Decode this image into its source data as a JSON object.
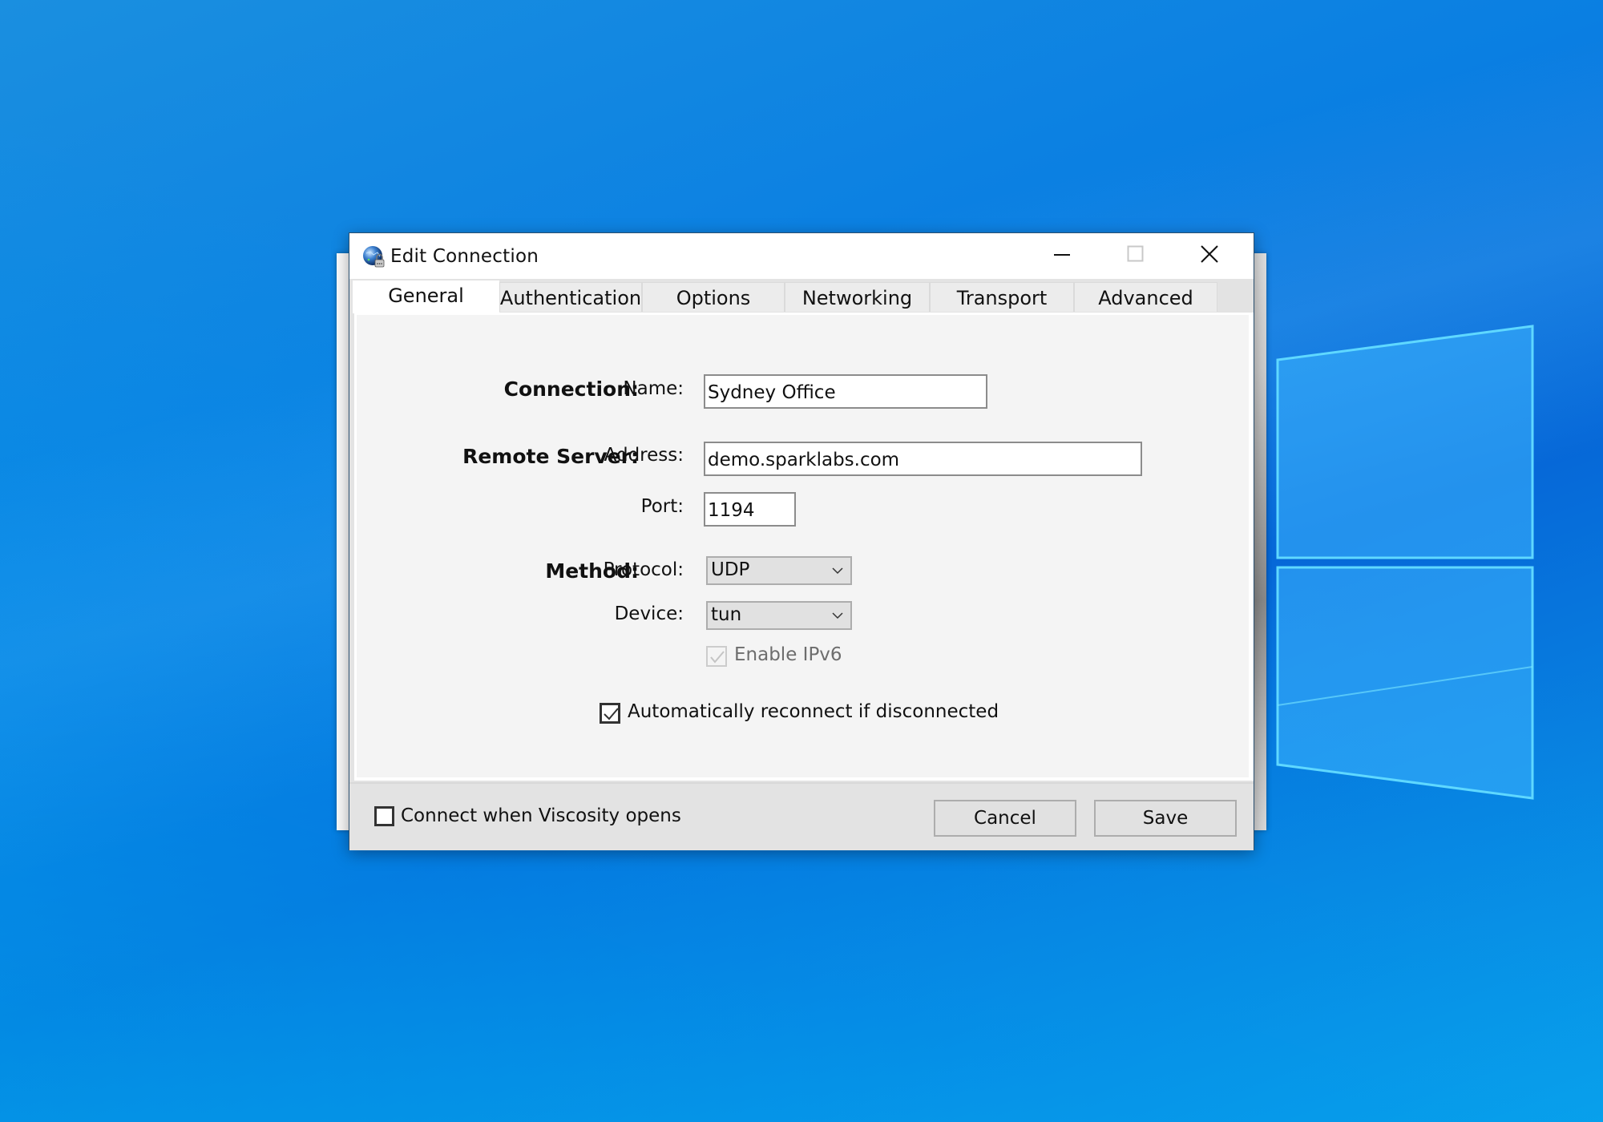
{
  "window": {
    "title": "Edit Connection",
    "app_icon": "globe-lock-icon",
    "controls": {
      "minimize": "minimize-icon",
      "maximize": "maximize-icon",
      "close": "close-icon"
    }
  },
  "tabs": [
    {
      "label": "General",
      "active": true
    },
    {
      "label": "Authentication",
      "active": false
    },
    {
      "label": "Options",
      "active": false
    },
    {
      "label": "Networking",
      "active": false
    },
    {
      "label": "Transport",
      "active": false
    },
    {
      "label": "Advanced",
      "active": false
    }
  ],
  "general": {
    "connection_section": "Connection:",
    "name_label": "Name:",
    "name_value": "Sydney Office",
    "remote_section": "Remote Server:",
    "address_label": "Address:",
    "address_value": "demo.sparklabs.com",
    "port_label": "Port:",
    "port_value": "1194",
    "method_section": "Method:",
    "protocol_label": "Protocol:",
    "protocol_value": "UDP",
    "device_label": "Device:",
    "device_value": "tun",
    "enable_ipv6_label": "Enable IPv6",
    "enable_ipv6_checked": true,
    "enable_ipv6_disabled": true,
    "auto_reconnect_label": "Automatically reconnect if disconnected",
    "auto_reconnect_checked": true
  },
  "footer": {
    "connect_on_open_label": "Connect when Viscosity opens",
    "connect_on_open_checked": false,
    "cancel_label": "Cancel",
    "save_label": "Save"
  },
  "colors": {
    "desktop_blue": "#0a7fe2",
    "window_bg": "#e3e3e3",
    "panel_bg": "#f4f4f4"
  }
}
